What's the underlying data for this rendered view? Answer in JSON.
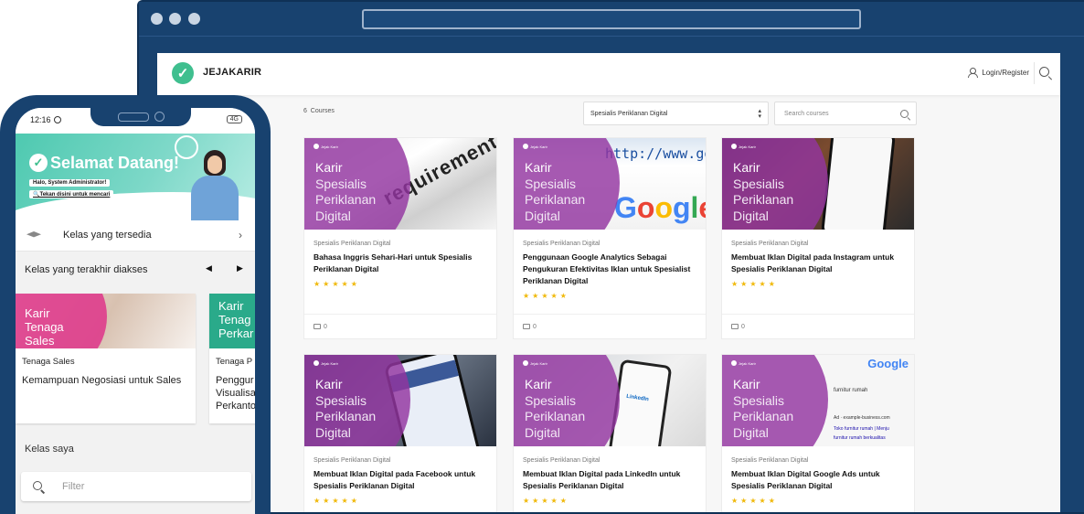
{
  "web": {
    "brand": "JEJAKARIR",
    "login_label": "Login/Register",
    "courses_count": "6",
    "courses_label": "Courses",
    "category_select": "Spesialis Periklanan Digital",
    "search_placeholder": "Search courses",
    "thumb_line1": "Karir",
    "thumb_line2": "Spesialis",
    "thumb_line3": "Periklanan",
    "thumb_line4": "Digital",
    "thumb_logo": "Jejak Karir",
    "courses": [
      {
        "category": "Spesialis Periklanan Digital",
        "title": "Bahasa Inggris Sehari-Hari untuk Spesialis Periklanan Digital",
        "stars": "★★★★★",
        "comments": "0"
      },
      {
        "category": "Spesialis Periklanan Digital",
        "title": "Penggunaan Google Analytics Sebagai Pengukuran Efektivitas Iklan untuk Spesialist Periklanan Digital",
        "stars": "★★★★★",
        "comments": "0"
      },
      {
        "category": "Spesialis Periklanan Digital",
        "title": "Membuat Iklan Digital pada Instagram untuk Spesialis Periklanan Digital",
        "stars": "★★★★★",
        "comments": "0"
      },
      {
        "category": "Spesialis Periklanan Digital",
        "title": "Membuat Iklan Digital pada Facebook untuk Spesialis Periklanan Digital",
        "stars": "★★★★★"
      },
      {
        "category": "Spesialis Periklanan Digital",
        "title": "Membuat Iklan Digital pada LinkedIn untuk Spesialis Periklanan Digital",
        "stars": "★★★★★"
      },
      {
        "category": "Spesialis Periklanan Digital",
        "title": "Membuat Iklan Digital Google Ads untuk Spesialis Periklanan Digital",
        "stars": "★★★★★"
      }
    ],
    "thumb_texts": {
      "english_word": "requirement",
      "url_text": "http://www.goog",
      "google_text": "Google",
      "ads_brand": "Google",
      "ads_query": "furnitur rumah",
      "ads_line": "Ad · example-business.com",
      "ads_link1": "Toko furnitur rumah | Menju",
      "ads_link2": "furnitur rumah berkualitas",
      "linkedin": "LinkedIn"
    }
  },
  "mobile": {
    "time": "12:16",
    "signal": "4G",
    "welcome": "Selamat Datang!",
    "greeting": "Halo, System Administrator!",
    "search_link": "Tekan disini untuk mencari",
    "available_label": "Kelas yang tersedia",
    "recent_label": "Kelas yang terakhir diakses",
    "recent_cards": [
      {
        "thumb_line1": "Karir",
        "thumb_line2": "Tenaga",
        "thumb_line3": "Sales",
        "category": "Tenaga Sales",
        "title": "Kemampuan Negosiasi untuk Sales"
      },
      {
        "thumb_line1": "Karir",
        "thumb_line2": "Tenag",
        "thumb_line3": "Perkar",
        "category": "Tenaga P",
        "title_l1": "Penggur",
        "title_l2": "Visualisa",
        "title_l3": "Perkanto"
      }
    ],
    "my_classes_label": "Kelas saya",
    "filter_placeholder": "Filter"
  },
  "colors": {
    "frame": "#18426f",
    "accent_green": "#3fbf8f",
    "thumb_purple": "#9234a0",
    "star": "#f0b90b"
  },
  "icons": [
    "logo-icon",
    "user-icon",
    "search-icon",
    "chevron-down-icon",
    "comment-icon",
    "graduation-cap-icon",
    "chevron-right-icon",
    "arrow-left-icon",
    "arrow-right-icon"
  ]
}
